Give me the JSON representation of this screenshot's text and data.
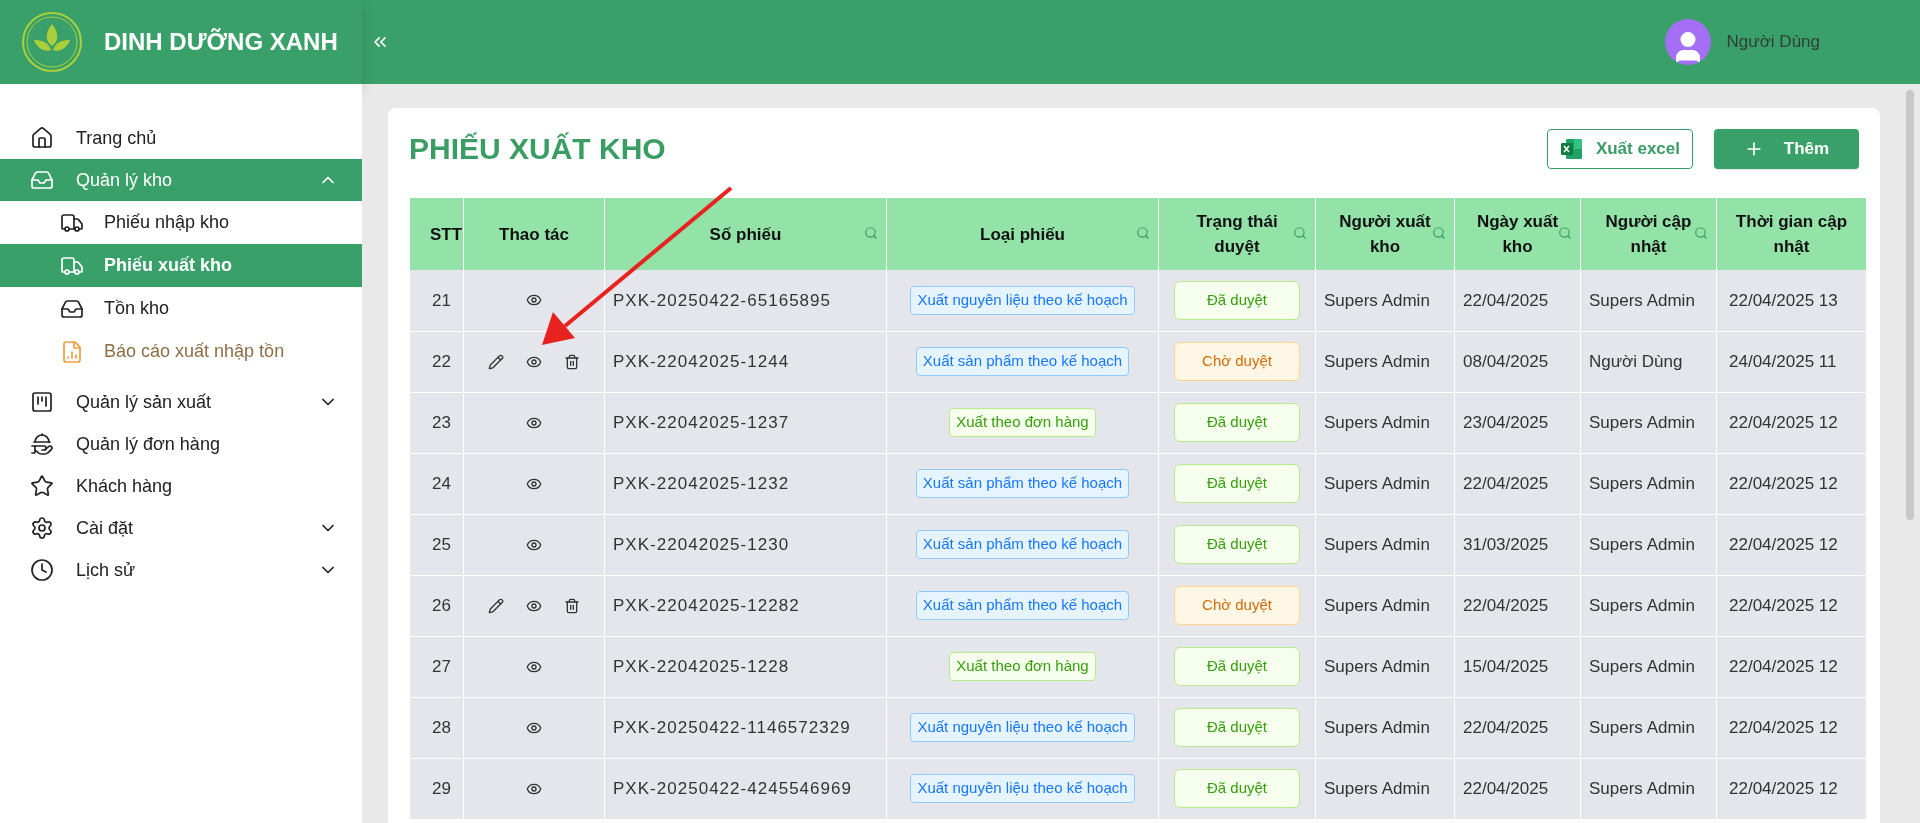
{
  "brand": {
    "name": "DINH DƯỠNG XANH"
  },
  "user": {
    "name": "Người Dùng"
  },
  "sidebar": {
    "items": [
      {
        "label": "Trang chủ",
        "selected": false
      },
      {
        "label": "Quản lý kho",
        "selected": true,
        "expanded": true,
        "children": [
          {
            "label": "Phiếu nhập kho",
            "selected": false,
            "kind": "page"
          },
          {
            "label": "Phiếu xuất kho",
            "selected": true,
            "kind": "page"
          },
          {
            "label": "Tồn kho",
            "selected": false,
            "kind": "page"
          },
          {
            "label": "Báo cáo xuất nhập tồn",
            "selected": false,
            "kind": "report"
          }
        ]
      },
      {
        "label": "Quản lý sản xuất",
        "selected": false,
        "expanded": false
      },
      {
        "label": "Quản lý đơn hàng",
        "selected": false
      },
      {
        "label": "Khách hàng",
        "selected": false
      },
      {
        "label": "Cài đặt",
        "selected": false,
        "expanded": false
      },
      {
        "label": "Lịch sử",
        "selected": false,
        "expanded": false
      }
    ]
  },
  "page": {
    "title": "PHIẾU XUẤT KHO",
    "buttons": [
      {
        "label": "Xuất excel",
        "kind": "excel"
      },
      {
        "label": "Thêm",
        "kind": "add"
      }
    ]
  },
  "table": {
    "columns": [
      {
        "label": "STT",
        "searchable": false
      },
      {
        "label": "Thao tác",
        "searchable": false
      },
      {
        "label": "Số phiếu",
        "searchable": true
      },
      {
        "label": "Loại phiếu",
        "searchable": true
      },
      {
        "label": "Trạng thái duyệt",
        "searchable": true
      },
      {
        "label": "Người xuất kho",
        "searchable": true
      },
      {
        "label": "Ngày xuất kho",
        "searchable": true
      },
      {
        "label": "Người cập nhật",
        "searchable": true
      },
      {
        "label": "Thời gian cập nhật",
        "searchable": false
      }
    ],
    "rows": [
      {
        "stt": "21",
        "editable": false,
        "code": "PXK-20250422-65165895",
        "type": {
          "label": "Xuất nguyên liệu theo kế hoạch",
          "kind": "plan"
        },
        "status": {
          "label": "Đã duyệt",
          "kind": "approved"
        },
        "issuer": "Supers Admin",
        "date": "22/04/2025",
        "updater": "Supers Admin",
        "updated": "22/04/2025 13"
      },
      {
        "stt": "22",
        "editable": true,
        "code": "PXK-22042025-1244",
        "type": {
          "label": "Xuất sản phẩm theo kế hoạch",
          "kind": "plan"
        },
        "status": {
          "label": "Chờ duyệt",
          "kind": "pending"
        },
        "issuer": "Supers Admin",
        "date": "08/04/2025",
        "updater": "Người Dùng",
        "updated": "24/04/2025 11"
      },
      {
        "stt": "23",
        "editable": false,
        "code": "PXK-22042025-1237",
        "type": {
          "label": "Xuất theo đơn hàng",
          "kind": "order"
        },
        "status": {
          "label": "Đã duyệt",
          "kind": "approved"
        },
        "issuer": "Supers Admin",
        "date": "23/04/2025",
        "updater": "Supers Admin",
        "updated": "22/04/2025 12"
      },
      {
        "stt": "24",
        "editable": false,
        "code": "PXK-22042025-1232",
        "type": {
          "label": "Xuất sản phẩm theo kế hoạch",
          "kind": "plan"
        },
        "status": {
          "label": "Đã duyệt",
          "kind": "approved"
        },
        "issuer": "Supers Admin",
        "date": "22/04/2025",
        "updater": "Supers Admin",
        "updated": "22/04/2025 12"
      },
      {
        "stt": "25",
        "editable": false,
        "code": "PXK-22042025-1230",
        "type": {
          "label": "Xuất sản phẩm theo kế hoạch",
          "kind": "plan"
        },
        "status": {
          "label": "Đã duyệt",
          "kind": "approved"
        },
        "issuer": "Supers Admin",
        "date": "31/03/2025",
        "updater": "Supers Admin",
        "updated": "22/04/2025 12"
      },
      {
        "stt": "26",
        "editable": true,
        "code": "PXK-22042025-12282",
        "type": {
          "label": "Xuất sản phẩm theo kế hoạch",
          "kind": "plan"
        },
        "status": {
          "label": "Chờ duyệt",
          "kind": "pending"
        },
        "issuer": "Supers Admin",
        "date": "22/04/2025",
        "updater": "Supers Admin",
        "updated": "22/04/2025 12"
      },
      {
        "stt": "27",
        "editable": false,
        "code": "PXK-22042025-1228",
        "type": {
          "label": "Xuất theo đơn hàng",
          "kind": "order"
        },
        "status": {
          "label": "Đã duyệt",
          "kind": "approved"
        },
        "issuer": "Supers Admin",
        "date": "15/04/2025",
        "updater": "Supers Admin",
        "updated": "22/04/2025 12"
      },
      {
        "stt": "28",
        "editable": false,
        "code": "PXK-20250422-1146572329",
        "type": {
          "label": "Xuất nguyên liệu theo kế hoạch",
          "kind": "plan"
        },
        "status": {
          "label": "Đã duyệt",
          "kind": "approved"
        },
        "issuer": "Supers Admin",
        "date": "22/04/2025",
        "updater": "Supers Admin",
        "updated": "22/04/2025 12"
      },
      {
        "stt": "29",
        "editable": false,
        "code": "PXK-20250422-4245546969",
        "type": {
          "label": "Xuất nguyên liệu theo kế hoạch",
          "kind": "plan"
        },
        "status": {
          "label": "Đã duyệt",
          "kind": "approved"
        },
        "issuer": "Supers Admin",
        "date": "22/04/2025",
        "updater": "Supers Admin",
        "updated": "22/04/2025 12"
      }
    ]
  }
}
